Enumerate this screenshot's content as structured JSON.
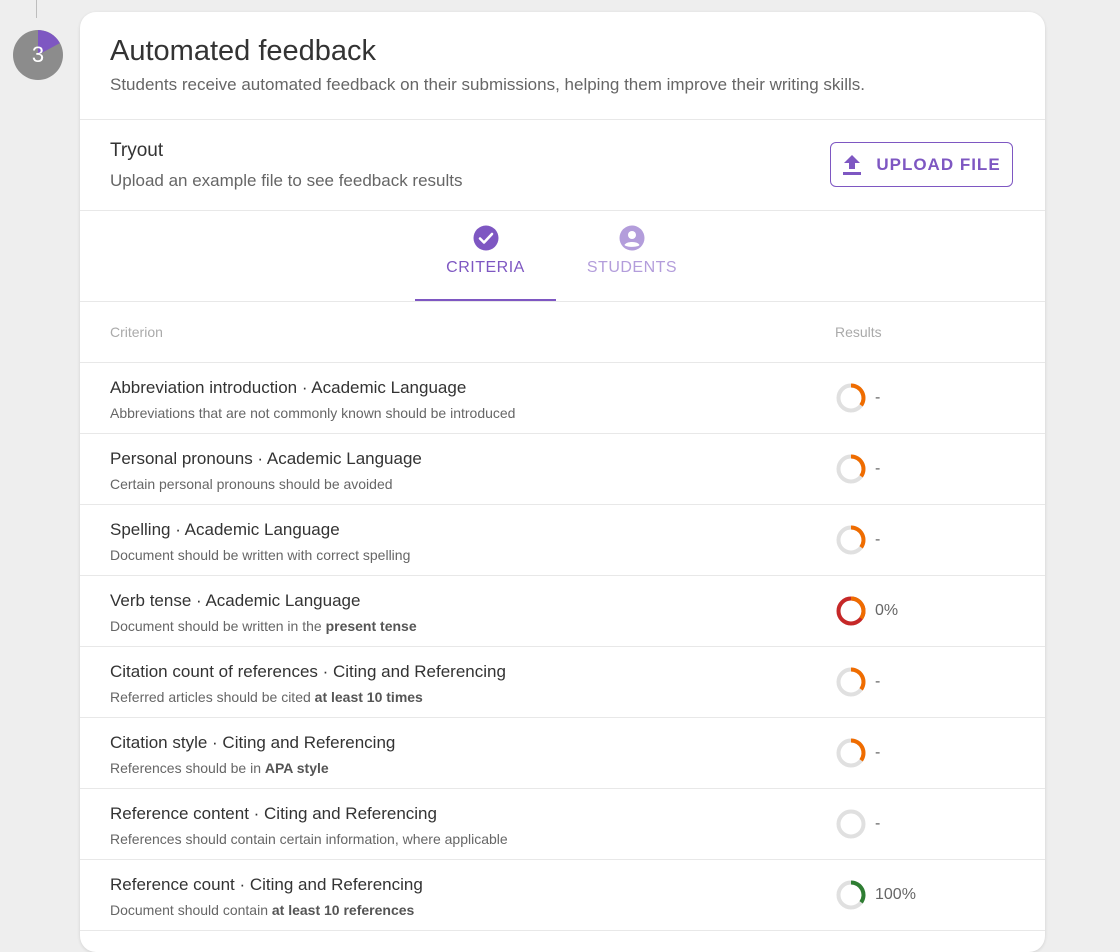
{
  "step": {
    "number": "3"
  },
  "header": {
    "title": "Automated feedback",
    "subtitle": "Students receive automated feedback on their submissions, helping them improve their writing skills."
  },
  "tryout": {
    "label": "Tryout",
    "description": "Upload an example file to see feedback results",
    "upload_label": "UPLOAD FILE"
  },
  "tabs": [
    {
      "label": "CRITERIA",
      "icon": "check-circle-icon",
      "active": true
    },
    {
      "label": "STUDENTS",
      "icon": "account-circle-icon",
      "active": false
    }
  ],
  "table": {
    "col_criterion": "Criterion",
    "col_results": "Results",
    "rows": [
      {
        "title": "Abbreviation introduction · Academic Language",
        "desc_pre": "Abbreviations that are not commonly known should be introduced",
        "desc_bold": "",
        "result": "-",
        "arc": 0.35,
        "arc_color": "#ef6c00"
      },
      {
        "title": "Personal pronouns · Academic Language",
        "desc_pre": "Certain personal pronouns should be avoided",
        "desc_bold": "",
        "result": "-",
        "arc": 0.35,
        "arc_color": "#ef6c00"
      },
      {
        "title": "Spelling · Academic Language",
        "desc_pre": "Document should be written with correct spelling",
        "desc_bold": "",
        "result": "-",
        "arc": 0.35,
        "arc_color": "#ef6c00"
      },
      {
        "title": "Verb tense · Academic Language",
        "desc_pre": "Document should be written in the ",
        "desc_bold": "present tense",
        "result": "0%",
        "arc": 1.0,
        "arc_color": "#c62828",
        "arc_color2": "#ef6c00"
      },
      {
        "title": "Citation count of references · Citing and Referencing",
        "desc_pre": "Referred articles should be cited ",
        "desc_bold": "at least 10 times",
        "result": "-",
        "arc": 0.35,
        "arc_color": "#ef6c00"
      },
      {
        "title": "Citation style · Citing and Referencing",
        "desc_pre": "References should be in ",
        "desc_bold": "APA style",
        "result": "-",
        "arc": 0.35,
        "arc_color": "#ef6c00"
      },
      {
        "title": "Reference content · Citing and Referencing",
        "desc_pre": "References should contain certain information, where applicable",
        "desc_bold": "",
        "result": "-",
        "arc": 0,
        "arc_color": "#ef6c00"
      },
      {
        "title": "Reference count · Citing and Referencing",
        "desc_pre": "Document should contain ",
        "desc_bold": "at least 10 references",
        "result": "100%",
        "arc": 0.35,
        "arc_color": "#2e7d32"
      }
    ]
  },
  "colors": {
    "accent": "#7e57c2",
    "accent_light": "#b39ddb",
    "warning": "#ef6c00",
    "error": "#c62828",
    "success": "#2e7d32"
  }
}
